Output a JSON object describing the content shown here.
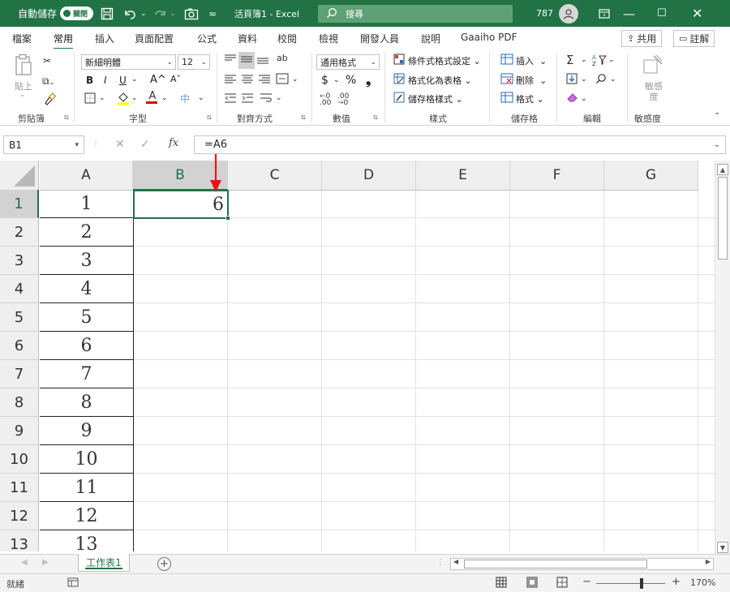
{
  "titlebar": {
    "autosave_label": "自動儲存",
    "autosave_state": "關閉",
    "doc_title": "活頁簿1 - Excel",
    "search_placeholder": "搜尋",
    "user_number": "787",
    "save_icon": "save-icon",
    "undo_icon": "undo-icon",
    "redo_icon": "redo-icon",
    "camera_icon": "camera-icon",
    "customize_icon": "customize-qat-icon",
    "ribbon_display_icon": "ribbon-display-icon",
    "minimize_icon": "minimize-icon",
    "maximize_icon": "maximize-icon",
    "close_icon": "close-icon",
    "bg_color": "#217346"
  },
  "tabs": {
    "items": [
      "檔案",
      "常用",
      "插入",
      "頁面配置",
      "公式",
      "資料",
      "校閱",
      "檢視",
      "開發人員",
      "說明",
      "Gaaiho PDF"
    ],
    "active": "常用",
    "share_label": "共用",
    "comments_label": "註解"
  },
  "ribbon": {
    "clipboard": {
      "label": "剪貼簿",
      "paste_label": "貼上"
    },
    "font": {
      "label": "字型",
      "font_name": "新細明體",
      "font_size": "12",
      "bold": "B",
      "italic": "I",
      "underline": "U",
      "grow": "A^",
      "shrink": "Aˇ",
      "font_color_letter": "A"
    },
    "alignment": {
      "label": "對齊方式"
    },
    "number": {
      "label": "數值",
      "format": "通用格式",
      "currency": "$",
      "percent": "%",
      "comma": "❟"
    },
    "styles": {
      "label": "樣式",
      "conditional": "條件式格式設定",
      "format_as_table": "格式化為表格",
      "cell_styles": "儲存格樣式"
    },
    "cells": {
      "label": "儲存格",
      "insert": "插入",
      "delete": "刪除",
      "format": "格式"
    },
    "editing": {
      "label": "編輯"
    },
    "sensitivity": {
      "label": "敏感度",
      "button": "敏感度"
    }
  },
  "formula_bar": {
    "name_box": "B1",
    "formula": "=A6",
    "fx": "fx"
  },
  "grid": {
    "columns": [
      "A",
      "B",
      "C",
      "D",
      "E",
      "F",
      "G"
    ],
    "selected_column": "B",
    "rows": [
      "1",
      "2",
      "3",
      "4",
      "5",
      "6",
      "7",
      "8",
      "9",
      "10",
      "11",
      "12",
      "13"
    ],
    "selected_row": "1",
    "column_a_values": [
      "1",
      "2",
      "3",
      "4",
      "5",
      "6",
      "7",
      "8",
      "9",
      "10",
      "11",
      "12",
      "13"
    ],
    "active_cell_value": "6"
  },
  "sheets": {
    "tabs": [
      "工作表1"
    ],
    "add_label": "+"
  },
  "status": {
    "ready": "就緒",
    "zoom": "170%",
    "zoom_minus": "−",
    "zoom_plus": "+"
  }
}
